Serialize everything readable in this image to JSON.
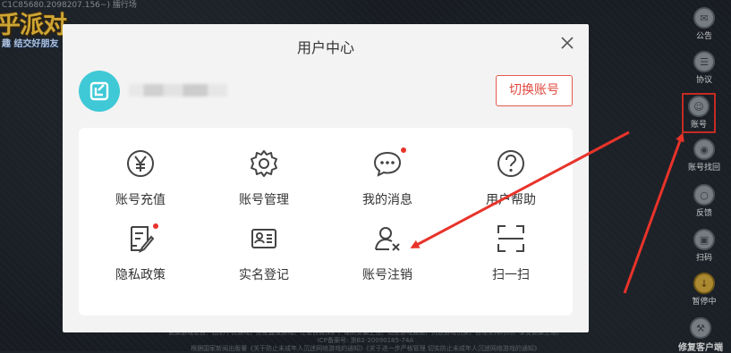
{
  "background": {
    "top_text": "C1C85680.2098207.156~)  擂行场",
    "logo_title": "乎派对",
    "logo_subtitle": "趣  结交好朋友",
    "footer_lines": [
      "健康游戏忠告：抵制不良游戏，拒绝盗版游戏。注意自我保护，谨防受骗上当。适度游戏益脑，沉迷游戏伤身。合理安排时间，享受健康生活。",
      "ICP备案号: 浙B2-20090185-74A",
      "根据国家新闻出版署《关于防止未成年人沉迷网络游戏的通知》《关于进一步严格管理 切实防止未成年人沉迷网络游戏的通知》"
    ]
  },
  "sidebar": {
    "items": [
      {
        "label": "公告",
        "icon": "bell-icon"
      },
      {
        "label": "协议",
        "icon": "document-icon"
      },
      {
        "label": "账号",
        "icon": "user-icon"
      },
      {
        "label": "账号找回",
        "icon": "key-icon"
      },
      {
        "label": "反馈",
        "icon": "chat-icon"
      },
      {
        "label": "扫码",
        "icon": "scan-icon"
      },
      {
        "label": "暂停中",
        "icon": "download-icon"
      },
      {
        "label": "修复客户端",
        "icon": "wrench-icon"
      }
    ],
    "highlighted": "账号",
    "highlight_color": "#e8332a"
  },
  "dialog": {
    "title": "用户中心",
    "close_icon": "close-icon",
    "avatar_color": "#3fc9d6",
    "switch_account_label": "切换账号",
    "grid": [
      {
        "label": "账号充值",
        "icon": "yen-icon",
        "badge": false
      },
      {
        "label": "账号管理",
        "icon": "gear-icon",
        "badge": false
      },
      {
        "label": "我的消息",
        "icon": "message-icon",
        "badge": true
      },
      {
        "label": "用户帮助",
        "icon": "help-icon",
        "badge": false
      },
      {
        "label": "隐私政策",
        "icon": "privacy-doc-icon",
        "badge": true
      },
      {
        "label": "实名登记",
        "icon": "id-card-icon",
        "badge": false
      },
      {
        "label": "账号注销",
        "icon": "user-remove-icon",
        "badge": false
      },
      {
        "label": "扫一扫",
        "icon": "scan-frame-icon",
        "badge": false
      }
    ],
    "accent_color": "#e04a3f"
  }
}
